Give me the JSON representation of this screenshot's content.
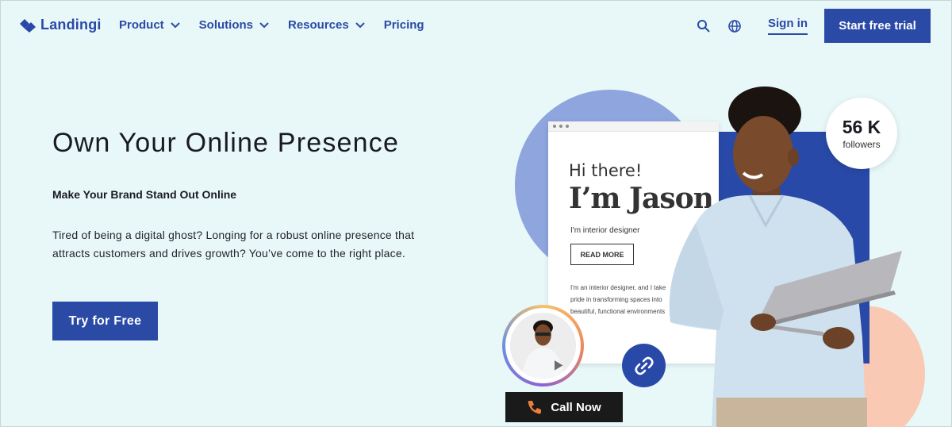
{
  "nav": {
    "logo_text": "Landingi",
    "menu": [
      {
        "label": "Product",
        "dropdown": true
      },
      {
        "label": "Solutions",
        "dropdown": true
      },
      {
        "label": "Resources",
        "dropdown": true
      },
      {
        "label": "Pricing",
        "dropdown": false
      }
    ],
    "icons": [
      "search-icon",
      "globe-icon"
    ],
    "sign_in": "Sign in",
    "trial_button": "Start free trial"
  },
  "hero": {
    "title": "Own Your Online Presence",
    "subtitle": "Make Your Brand Stand Out Online",
    "description": "Tired of being a digital ghost? Longing for a robust online presence that attracts customers and drives growth? You’ve come to the right place.",
    "cta": "Try for Free"
  },
  "mockup": {
    "greeting": "Hi there!",
    "name": "I’m Jason",
    "role": "I'm interior designer",
    "read_more": "READ MORE",
    "body_lines": [
      "I'm an interior designer, and I take",
      "pride in transforming spaces into",
      "beautiful, functional environments"
    ]
  },
  "followers": {
    "count": "56 K",
    "label": "followers"
  },
  "call_button": "Call Now",
  "colors": {
    "brand": "#2a4aa6",
    "background": "#e8f8f8",
    "accent_peach": "#f9c9b4",
    "accent_lightblue": "#8fa5dd"
  }
}
